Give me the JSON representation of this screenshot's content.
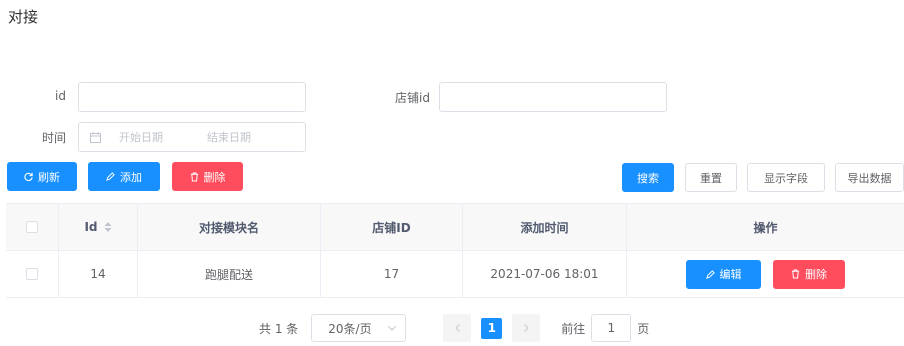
{
  "page_title": "对接",
  "search": {
    "id_label": "id",
    "id_value": "",
    "store_label": "店铺id",
    "store_value": "",
    "time_label": "时间",
    "start_placeholder": "开始日期",
    "end_placeholder": "结束日期"
  },
  "toolbar": {
    "refresh": "刷新",
    "add": "添加",
    "delete": "删除",
    "search": "搜索",
    "reset": "重置",
    "show_fields": "显示字段",
    "export": "导出数据"
  },
  "table": {
    "headers": [
      "Id",
      "对接模块名",
      "店铺ID",
      "添加时间",
      "操作"
    ],
    "rows": [
      {
        "id": "14",
        "module": "跑腿配送",
        "store": "17",
        "time": "2021-07-06 18:01",
        "edit": "编辑",
        "delete": "删除"
      }
    ]
  },
  "pagination": {
    "total": "共 1 条",
    "page_size": "20条/页",
    "current": "1",
    "goto_prefix": "前往",
    "goto_value": "1",
    "goto_suffix": "页"
  },
  "colors": {
    "primary": "#1890ff",
    "danger": "#ff4d5e"
  }
}
